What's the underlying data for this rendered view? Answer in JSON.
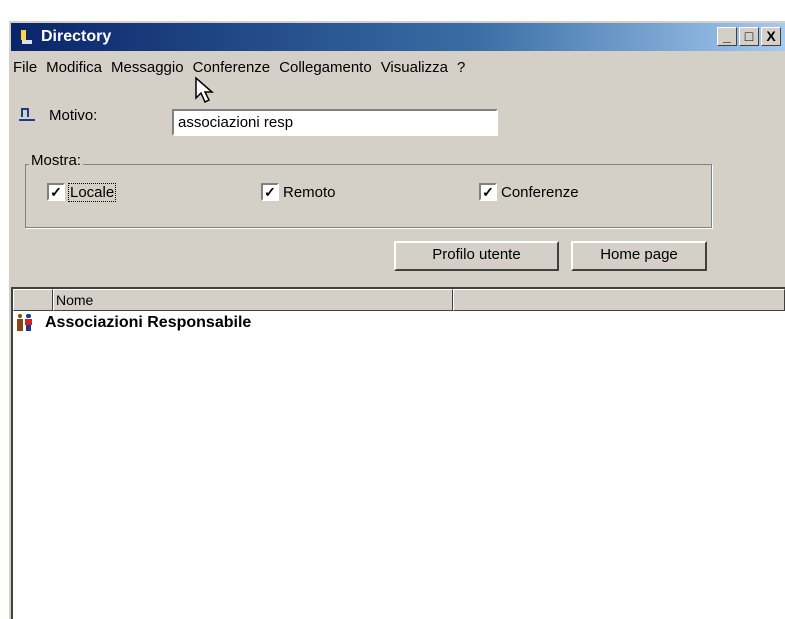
{
  "window": {
    "title": "Directory",
    "controls": [
      "_",
      "□",
      "X"
    ]
  },
  "menubar": {
    "items": [
      "File",
      "Modifica",
      "Messaggio",
      "Conferenze",
      "Collegamento",
      "Visualizza",
      "?"
    ]
  },
  "search": {
    "label": "Motivo:",
    "value": "associazioni resp"
  },
  "filters": {
    "legend": "Mostra:",
    "locale": {
      "label": "Locale",
      "checked": true
    },
    "remoto": {
      "label": "Remoto",
      "checked": true
    },
    "conferenze": {
      "label": "Conferenze",
      "checked": true
    }
  },
  "buttons": {
    "profilo": "Profilo utente",
    "homepage": "Home page"
  },
  "list": {
    "column_name": "Nome",
    "rows": [
      {
        "name": "Associazioni Responsabile",
        "icon": "conference-icon"
      }
    ]
  },
  "check_glyph": "✓"
}
